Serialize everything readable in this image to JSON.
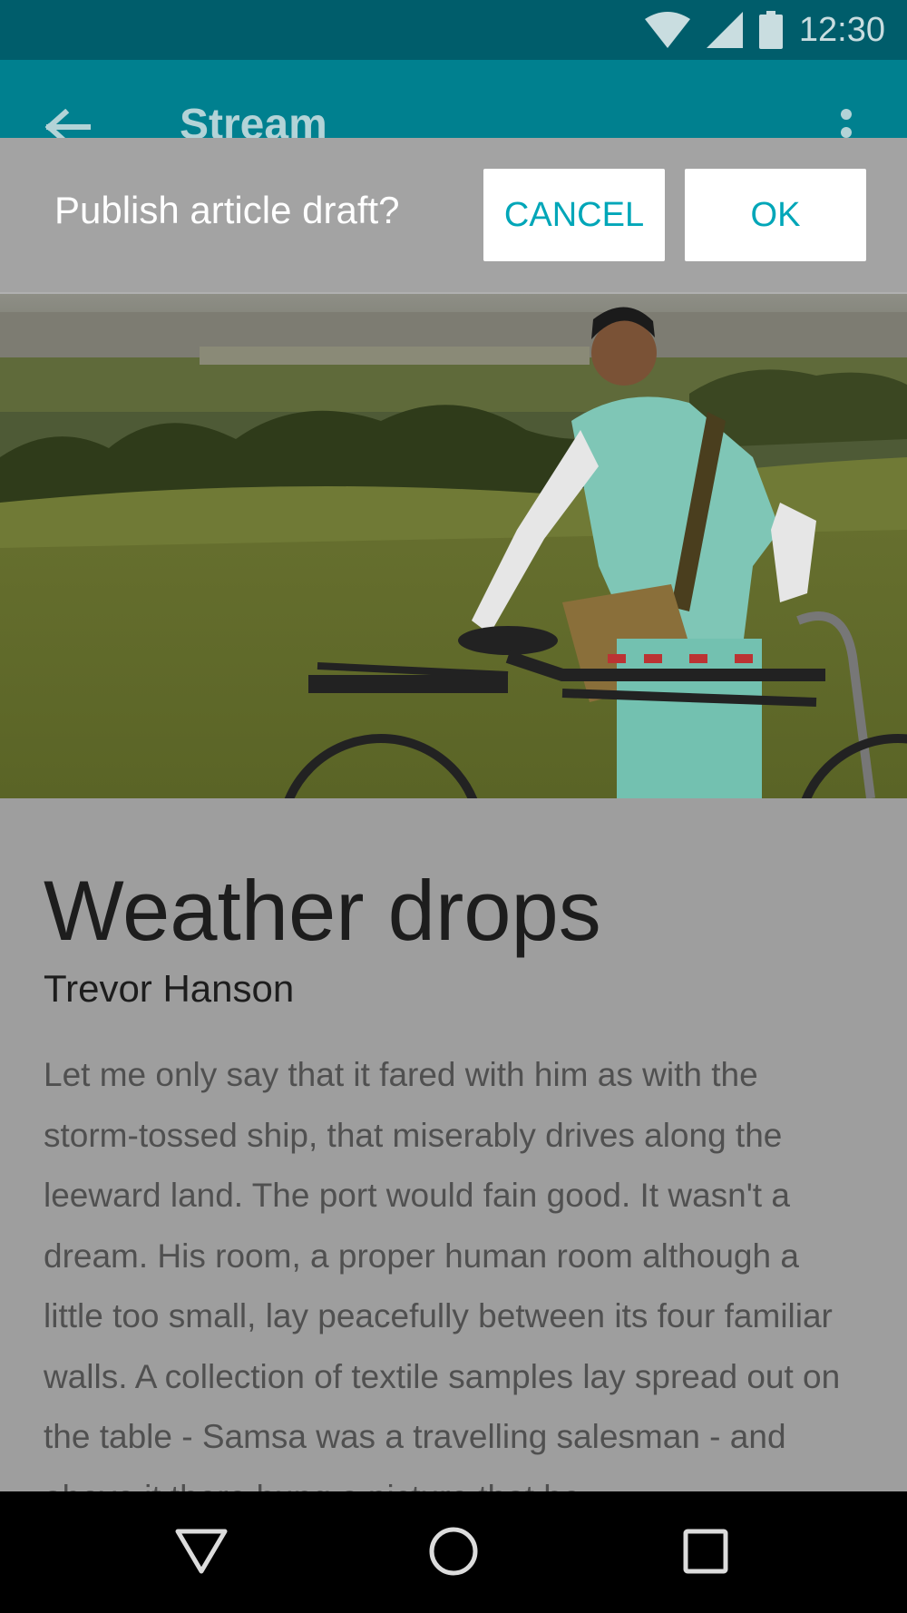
{
  "status_bar": {
    "time": "12:30",
    "icons": [
      "wifi-icon",
      "signal-icon",
      "battery-icon"
    ]
  },
  "app_bar": {
    "title": "Stream",
    "back_icon": "arrow-back-icon",
    "more_icon": "more-vert-icon"
  },
  "dialog": {
    "message": "Publish article draft?",
    "cancel_label": "CANCEL",
    "ok_label": "OK"
  },
  "article": {
    "title": "Weather drops",
    "author": "Trevor Hanson",
    "body": "Let me only say that it fared with him as with the storm-tossed ship, that miserably drives along the leeward land. The port would fain good. It wasn't a dream. His room, a proper human room although a little too small, lay peacefully between its four familiar walls. A collection of textile samples lay spread out on the table - Samsa was a travelling salesman - and above it there hung a picture that he"
  },
  "nav_bar": {
    "buttons": [
      "back-triangle-icon",
      "home-circle-icon",
      "recents-square-icon"
    ]
  },
  "colors": {
    "status_bar": "#005d6b",
    "app_bar": "#00808f",
    "accent": "#00a6b8",
    "scrim": "#9e9e9e"
  }
}
